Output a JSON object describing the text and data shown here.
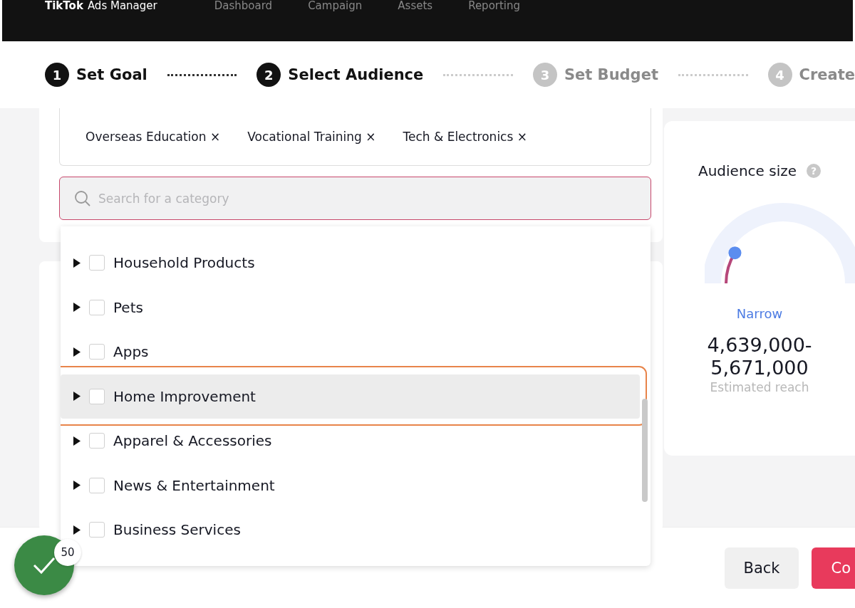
{
  "header": {
    "logo": "TikTok",
    "product": "Ads Manager",
    "nav": [
      "Dashboard",
      "Campaign",
      "Assets",
      "Reporting"
    ]
  },
  "steps": [
    {
      "number": "1",
      "label": "Set Goal",
      "active": true
    },
    {
      "number": "2",
      "label": "Select Audience",
      "active": true
    },
    {
      "number": "3",
      "label": "Set Budget",
      "active": false
    },
    {
      "number": "4",
      "label": "Create",
      "active": false
    }
  ],
  "selected_tags": [
    "Overseas Education",
    "Vocational Training",
    "Tech & Electronics"
  ],
  "tag_remove": "×",
  "search": {
    "placeholder": "Search for a category"
  },
  "categories": [
    {
      "label": "Household Products",
      "checked": false,
      "highlighted": false
    },
    {
      "label": "Pets",
      "checked": false,
      "highlighted": false
    },
    {
      "label": "Apps",
      "checked": false,
      "highlighted": false
    },
    {
      "label": "Home Improvement",
      "checked": false,
      "highlighted": true
    },
    {
      "label": "Apparel & Accessories",
      "checked": false,
      "highlighted": false
    },
    {
      "label": "News & Entertainment",
      "checked": false,
      "highlighted": false
    },
    {
      "label": "Business Services",
      "checked": false,
      "highlighted": false
    }
  ],
  "audience": {
    "title": "Audience size",
    "help": "?",
    "level": 0.2,
    "rating": "Narrow",
    "reach": "4,639,000-\n5,671,000",
    "reach_label": "Estimated reach"
  },
  "progress_badge": {
    "count": "50"
  },
  "buttons": [
    {
      "label": "Back",
      "kind": "secondary"
    },
    {
      "label": "Co",
      "kind": "primary"
    }
  ]
}
